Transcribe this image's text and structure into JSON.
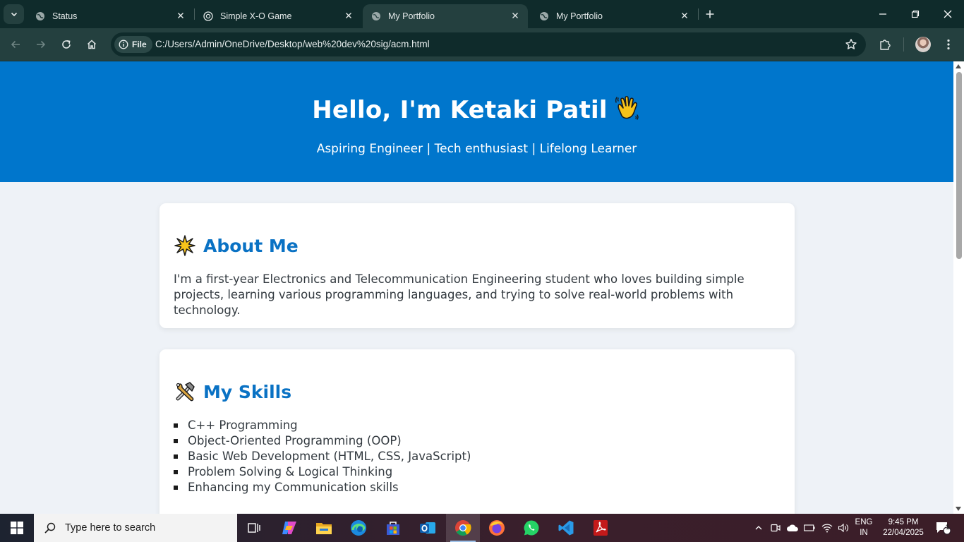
{
  "browser": {
    "tabs": [
      {
        "title": "Status",
        "active": false
      },
      {
        "title": "Simple X-O Game",
        "active": false
      },
      {
        "title": "My Portfolio",
        "active": true
      },
      {
        "title": "My Portfolio",
        "active": false
      }
    ],
    "site_chip": "File",
    "url": "C:/Users/Admin/OneDrive/Desktop/web%20dev%20sig/acm.html"
  },
  "page": {
    "hero": {
      "title": "Hello, I'm Ketaki Patil",
      "subtitle": "Aspiring Engineer | Tech enthusiast | Lifelong Learner"
    },
    "about": {
      "heading": "About Me",
      "text": "I'm a first-year Electronics and Telecommunication Engineering student who loves building simple projects, learning various programming languages, and trying to solve real-world problems with technology."
    },
    "skills": {
      "heading": "My Skills",
      "items": [
        "C++ Programming",
        "Object-Oriented Programming (OOP)",
        "Basic Web Development (HTML, CSS, JavaScript)",
        "Problem Solving & Logical Thinking",
        "Enhancing my Communication skills"
      ]
    }
  },
  "taskbar": {
    "search_placeholder": "Type here to search",
    "lang_line1": "ENG",
    "lang_line2": "IN",
    "time": "9:45 PM",
    "date": "22/04/2025",
    "notification_count": "1"
  },
  "colors": {
    "hero_bg": "#0076cc",
    "heading_blue": "#0a72c4",
    "page_bg": "#eef2f7"
  }
}
